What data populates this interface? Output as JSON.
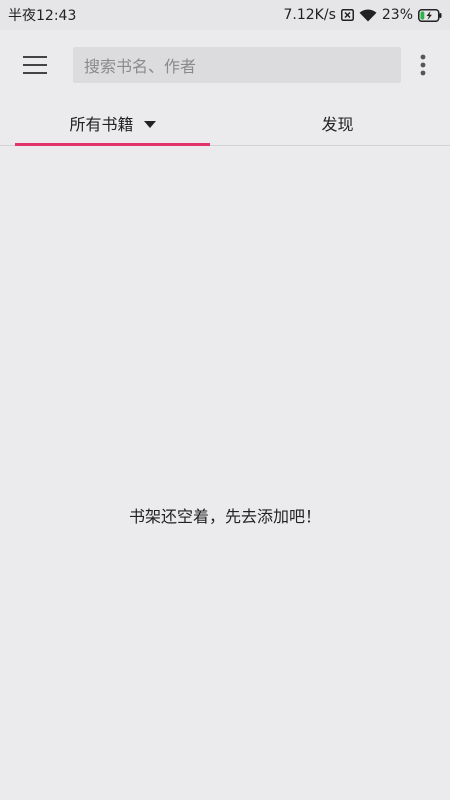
{
  "status_bar": {
    "time": "半夜12:43",
    "network_speed": "7.12K/s",
    "battery_percent": "23%",
    "battery_level": 0.23,
    "icons": [
      "sim-missing-icon",
      "wifi-icon",
      "battery-charging-icon"
    ]
  },
  "toolbar": {
    "menu_icon": "hamburger-menu-icon",
    "search_placeholder": "搜索书名、作者",
    "more_icon": "more-vertical-icon"
  },
  "tabs": [
    {
      "label": "所有书籍",
      "selected": true,
      "icon": "caret-down-icon"
    },
    {
      "label": "发现",
      "selected": false
    }
  ],
  "colors": {
    "accent": "#e2336b",
    "background": "#ebebed",
    "search_bg": "#dcdcde"
  },
  "main": {
    "empty_message": "书架还空着，先去添加吧！"
  }
}
